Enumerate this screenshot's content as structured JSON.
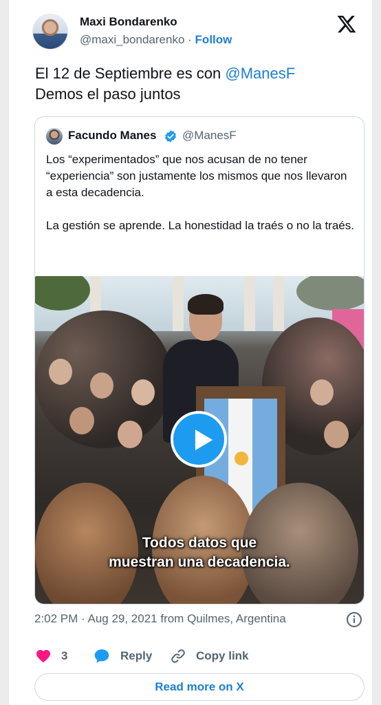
{
  "author": {
    "name": "Maxi Bondarenko",
    "handle": "@maxi_bondarenko",
    "separator": "·",
    "follow_label": "Follow"
  },
  "tweet": {
    "text_line1_prefix": "El 12 de Septiembre es con ",
    "mention": "@ManesF",
    "text_line2": "Demos el paso juntos"
  },
  "quoted": {
    "name": "Facundo Manes",
    "handle": "@ManesF",
    "paragraph1": "Los “experimentados” que nos acusan de no tener “experiencia” son justamente los mismos que nos llevaron a esta decadencia.",
    "paragraph2": "La gestión se aprende. La honestidad la traés o no la traés.",
    "video_caption_line1": "Todos datos que",
    "video_caption_line2": "muestran una decadencia."
  },
  "meta": {
    "timestamp": "2:02 PM · Aug 29, 2021 from Quilmes, Argentina"
  },
  "actions": {
    "like_count": "3",
    "reply_label": "Reply",
    "copy_label": "Copy link"
  },
  "read_more_label": "Read more on X",
  "icons": {
    "brand": "x-logo-icon",
    "verified": "verified-badge-icon",
    "info": "info-icon",
    "like": "heart-icon",
    "reply": "reply-bubble-icon",
    "copy": "link-icon",
    "play": "play-icon"
  },
  "colors": {
    "link": "#1d7fd0",
    "like": "#f91880",
    "play": "#1d9bf0",
    "secondary_text": "#536471"
  }
}
